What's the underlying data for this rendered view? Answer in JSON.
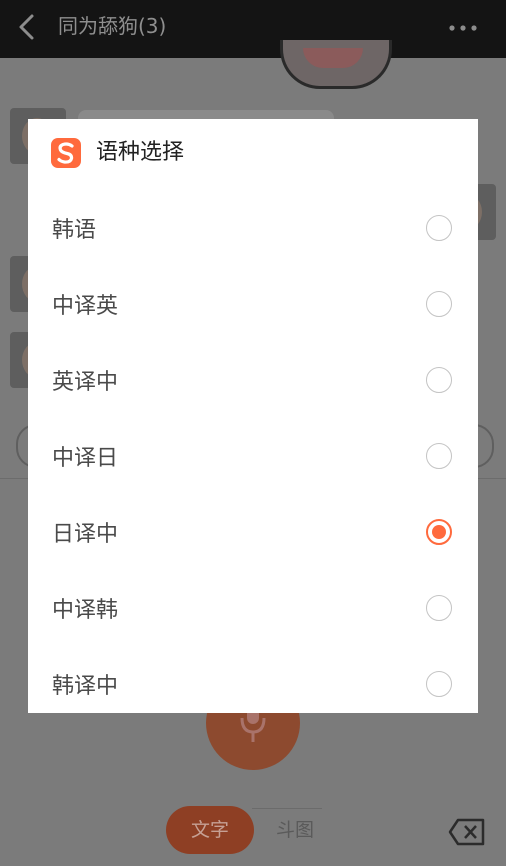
{
  "chat": {
    "title": "同为舔狗(3)"
  },
  "input_panel": {
    "tabs": [
      {
        "label": "文字"
      },
      {
        "label": "斗图"
      }
    ]
  },
  "dialog": {
    "title": "语种选择",
    "options": [
      {
        "label": "韩语",
        "selected": false
      },
      {
        "label": "中译英",
        "selected": false
      },
      {
        "label": "英译中",
        "selected": false
      },
      {
        "label": "中译日",
        "selected": false
      },
      {
        "label": "日译中",
        "selected": true
      },
      {
        "label": "中译韩",
        "selected": false
      },
      {
        "label": "韩译中",
        "selected": false
      }
    ]
  },
  "colors": {
    "accent": "#ff6a3d",
    "overlay": "#7b7b7b"
  }
}
